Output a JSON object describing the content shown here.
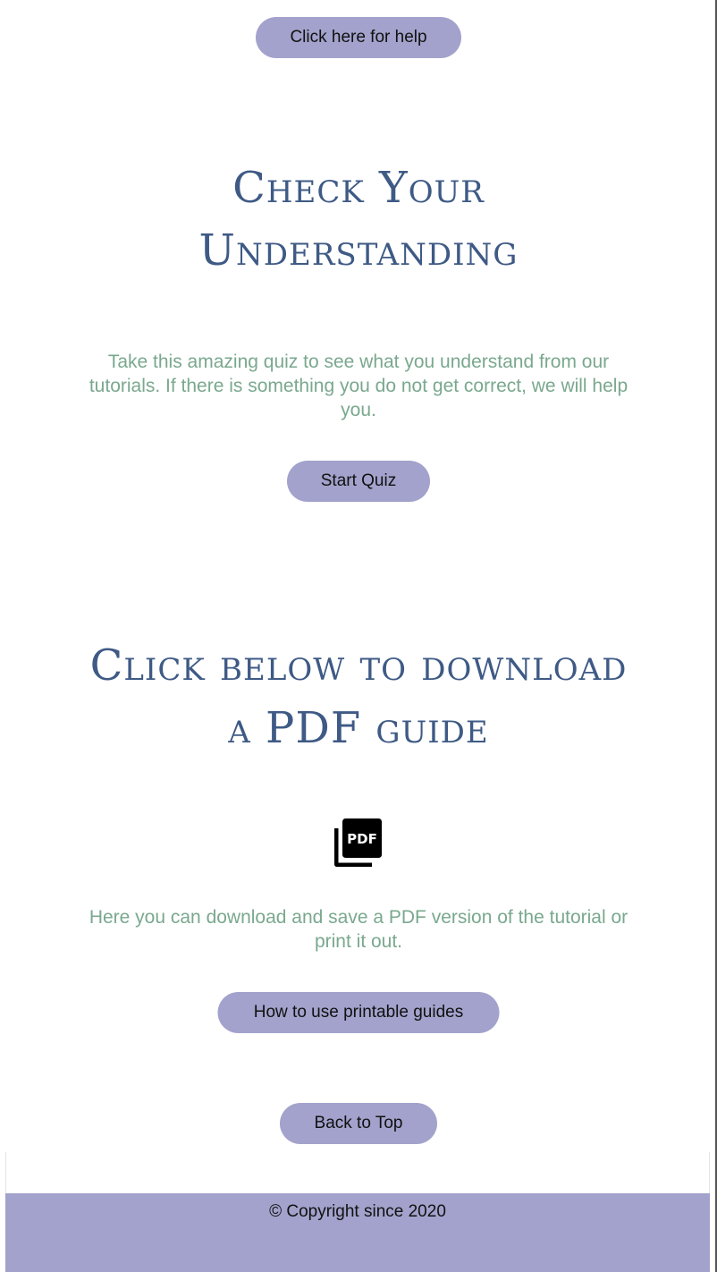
{
  "help": {
    "label": "Click here for help"
  },
  "quiz_section": {
    "heading_line1": "Check Your",
    "heading_line2": "Understanding",
    "description": "Take this amazing quiz to see what you understand from our tutorials. If there is something you do not get correct, we will help you.",
    "button_label": "Start Quiz"
  },
  "download_section": {
    "heading_line1": "Click below to download",
    "heading_line2": "a PDF guide",
    "icon": "pdf-icon",
    "description": "Here you can download and save a PDF version of the tutorial or print it out.",
    "button_label": "How to use printable guides"
  },
  "back_to_top": {
    "label": "Back to Top"
  },
  "footer": {
    "copyright": "© Copyright since 2020"
  },
  "colors": {
    "button_bg": "#a2a2cc",
    "heading": "#3e5a85",
    "paragraph": "#7aa88e",
    "footer_bg": "#a2a2cc"
  }
}
